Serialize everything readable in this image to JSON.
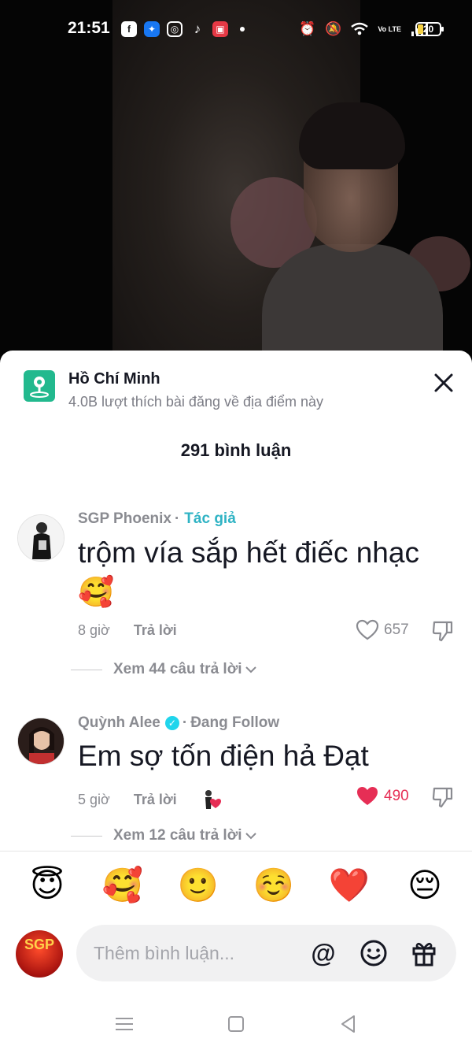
{
  "status_bar": {
    "time": "21:51",
    "apps": [
      "facebook-icon",
      "messenger-icon",
      "instagram-icon",
      "tiktok-icon",
      "screen-record-icon"
    ],
    "battery": "20",
    "network": "Vo LTE"
  },
  "location": {
    "title": "Hồ Chí Minh",
    "subtitle": "4.0B lượt thích bài đăng về địa điểm này"
  },
  "comments_header": "291 bình luận",
  "comments": [
    {
      "username": "SGP Phoenix",
      "separator": "·",
      "tag": "Tác giả",
      "text": "trộm vía sắp hết điếc nhạc 🥰",
      "time": "8 giờ",
      "reply_label": "Trả lời",
      "likes": "657",
      "liked": false,
      "view_replies": "Xem 44 câu trả lời"
    },
    {
      "username": "Quỳnh Alee",
      "separator": "·",
      "tag": "Đang Follow",
      "verified": true,
      "text": "Em sợ tốn điện hả Đạt",
      "time": "5 giờ",
      "reply_label": "Trả lời",
      "likes": "490",
      "liked": true,
      "view_replies": "Xem 12 câu trả lời"
    }
  ],
  "emoji_bar": [
    "😇",
    "🥰",
    "🙂",
    "☺️",
    "❤️",
    "😔"
  ],
  "input": {
    "placeholder": "Thêm bình luận..."
  },
  "colors": {
    "accent_teal": "#2fb3c4",
    "like_red": "#e62e55",
    "location_green": "#22b98e"
  }
}
